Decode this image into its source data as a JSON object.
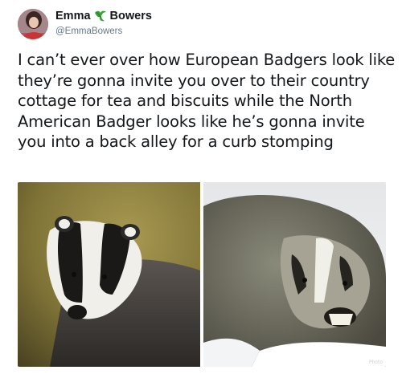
{
  "user": {
    "display_name_first": "Emma",
    "display_name_last": "Bowers",
    "handle": "@EmmaBowers",
    "emoji_icon": "leaf-icon"
  },
  "tweet": {
    "text": "I can’t ever over how European Badgers look like they’re gonna invite you over to their country cottage for tea and biscuits while the North American Badger looks like he’s gonna invite you into a back alley for a curb stomping"
  },
  "media": {
    "photo_left_icon": "european-badger-photo",
    "photo_right_icon": "american-badger-photo",
    "photo_right_watermark": "Photo"
  },
  "colors": {
    "text_primary": "#14171a",
    "text_secondary": "#657786"
  }
}
